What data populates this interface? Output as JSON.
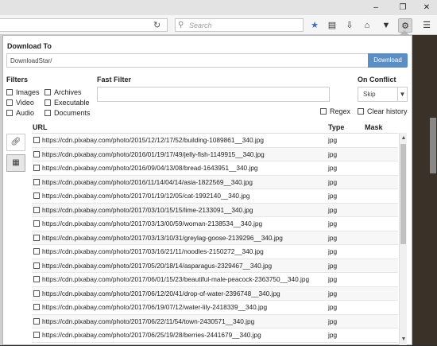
{
  "browser": {
    "search_placeholder": "Search",
    "icons": [
      "restore-icon",
      "maximize-icon",
      "close-icon",
      "reload-icon",
      "star-icon",
      "reader-icon",
      "download-icon",
      "home-icon",
      "pocket-icon",
      "extension-icon",
      "menu-icon"
    ]
  },
  "download_to": {
    "label": "Download To",
    "path": "DownloadStar/",
    "button": "Download"
  },
  "filters": {
    "label": "Filters",
    "items": [
      {
        "label": "Images",
        "checked": false
      },
      {
        "label": "Archives",
        "checked": false
      },
      {
        "label": "Video",
        "checked": false
      },
      {
        "label": "Executable",
        "checked": false
      },
      {
        "label": "Audio",
        "checked": false
      },
      {
        "label": "Documents",
        "checked": false
      }
    ]
  },
  "fast_filter": {
    "label": "Fast Filter",
    "value": "",
    "regex_label": "Regex",
    "clear_history_label": "Clear history"
  },
  "on_conflict": {
    "label": "On Conflict",
    "selected": "Skip"
  },
  "table": {
    "columns": [
      "URL",
      "Type",
      "Mask"
    ],
    "rows": [
      {
        "url": "https://cdn.pixabay.com/photo/2015/12/12/17/52/building-1089861__340.jpg",
        "type": "jpg"
      },
      {
        "url": "https://cdn.pixabay.com/photo/2016/01/19/17/49/jelly-fish-1149915__340.jpg",
        "type": "jpg"
      },
      {
        "url": "https://cdn.pixabay.com/photo/2016/09/04/13/08/bread-1643951__340.jpg",
        "type": "jpg"
      },
      {
        "url": "https://cdn.pixabay.com/photo/2016/11/14/04/14/asia-1822569__340.jpg",
        "type": "jpg"
      },
      {
        "url": "https://cdn.pixabay.com/photo/2017/01/19/12/05/cat-1992140__340.jpg",
        "type": "jpg"
      },
      {
        "url": "https://cdn.pixabay.com/photo/2017/03/10/15/15/lime-2133091__340.jpg",
        "type": "jpg"
      },
      {
        "url": "https://cdn.pixabay.com/photo/2017/03/13/00/59/woman-2138534__340.jpg",
        "type": "jpg"
      },
      {
        "url": "https://cdn.pixabay.com/photo/2017/03/13/10/31/greylag-goose-2139296__340.jpg",
        "type": "jpg"
      },
      {
        "url": "https://cdn.pixabay.com/photo/2017/03/16/21/11/noodles-2150272__340.jpg",
        "type": "jpg"
      },
      {
        "url": "https://cdn.pixabay.com/photo/2017/05/20/18/14/asparagus-2329467__340.jpg",
        "type": "jpg"
      },
      {
        "url": "https://cdn.pixabay.com/photo/2017/06/01/15/23/beautiful-male-peacock-2363750__340.jpg",
        "type": "jpg"
      },
      {
        "url": "https://cdn.pixabay.com/photo/2017/06/12/20/41/drop-of-water-2396748__340.jpg",
        "type": "jpg"
      },
      {
        "url": "https://cdn.pixabay.com/photo/2017/06/19/07/12/water-lily-2418339__340.jpg",
        "type": "jpg"
      },
      {
        "url": "https://cdn.pixabay.com/photo/2017/06/22/11/54/town-2430571__340.jpg",
        "type": "jpg"
      },
      {
        "url": "https://cdn.pixabay.com/photo/2017/06/25/19/28/berries-2441679__340.jpg",
        "type": "jpg"
      }
    ]
  },
  "colors": {
    "accent": "#5c8ec6"
  }
}
